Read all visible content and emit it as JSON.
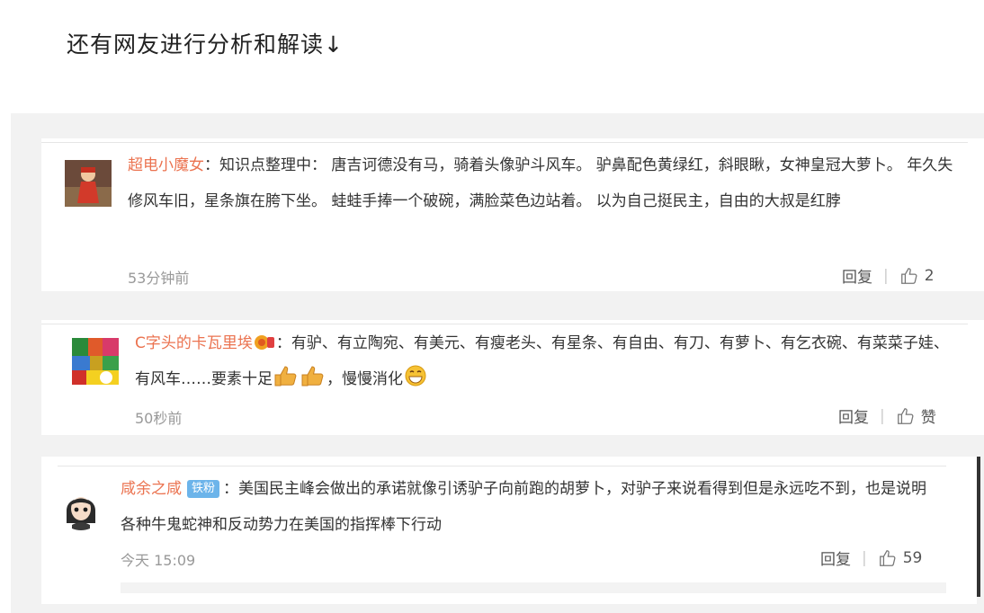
{
  "heading": "还有网友进行分析和解读↓",
  "comments": [
    {
      "user": "超电小魔女",
      "sep": "：",
      "text": "知识点整理中： 唐吉诃德没有马，骑着头像驴斗风车。 驴鼻配色黄绿红，斜眼瞅，女神皇冠大萝卜。 年久失修风车旧，星条旗在胯下坐。 蛙蛙手捧一个破碗，满脸菜色边站着。 以为自己挺民主，自由的大叔是红脖",
      "time": "53分钟前",
      "reply": "回复",
      "like": "2",
      "avatar_icon": "avatar-red-figure-icon"
    },
    {
      "user": "C字头的卡瓦里埃",
      "sep": "：",
      "text_before": "有驴、有立陶宛、有美元、有瘦老头、有星条、有自由、有刀、有萝卜、有乞衣碗、有菜菜子娃、有风车……要素十足",
      "text_after": "，慢慢消化",
      "time": "50秒前",
      "reply": "回复",
      "like": "赞",
      "avatar_icon": "avatar-colorful-blocks-icon"
    },
    {
      "user": "咸余之咸",
      "badge": "铁粉",
      "sep": "：",
      "text": "美国民主峰会做出的承诺就像引诱驴子向前跑的胡萝卜，对驴子来说看得到但是永远吃不到，也是说明各种牛鬼蛇神和反动势力在美国的指挥棒下行动",
      "time": "今天 15:09",
      "reply": "回复",
      "like": "59",
      "avatar_icon": "avatar-cartoon-girl-icon"
    }
  ],
  "colors": {
    "username": "#eb7350",
    "badge": "#6cb4ea",
    "muted": "#999999"
  }
}
